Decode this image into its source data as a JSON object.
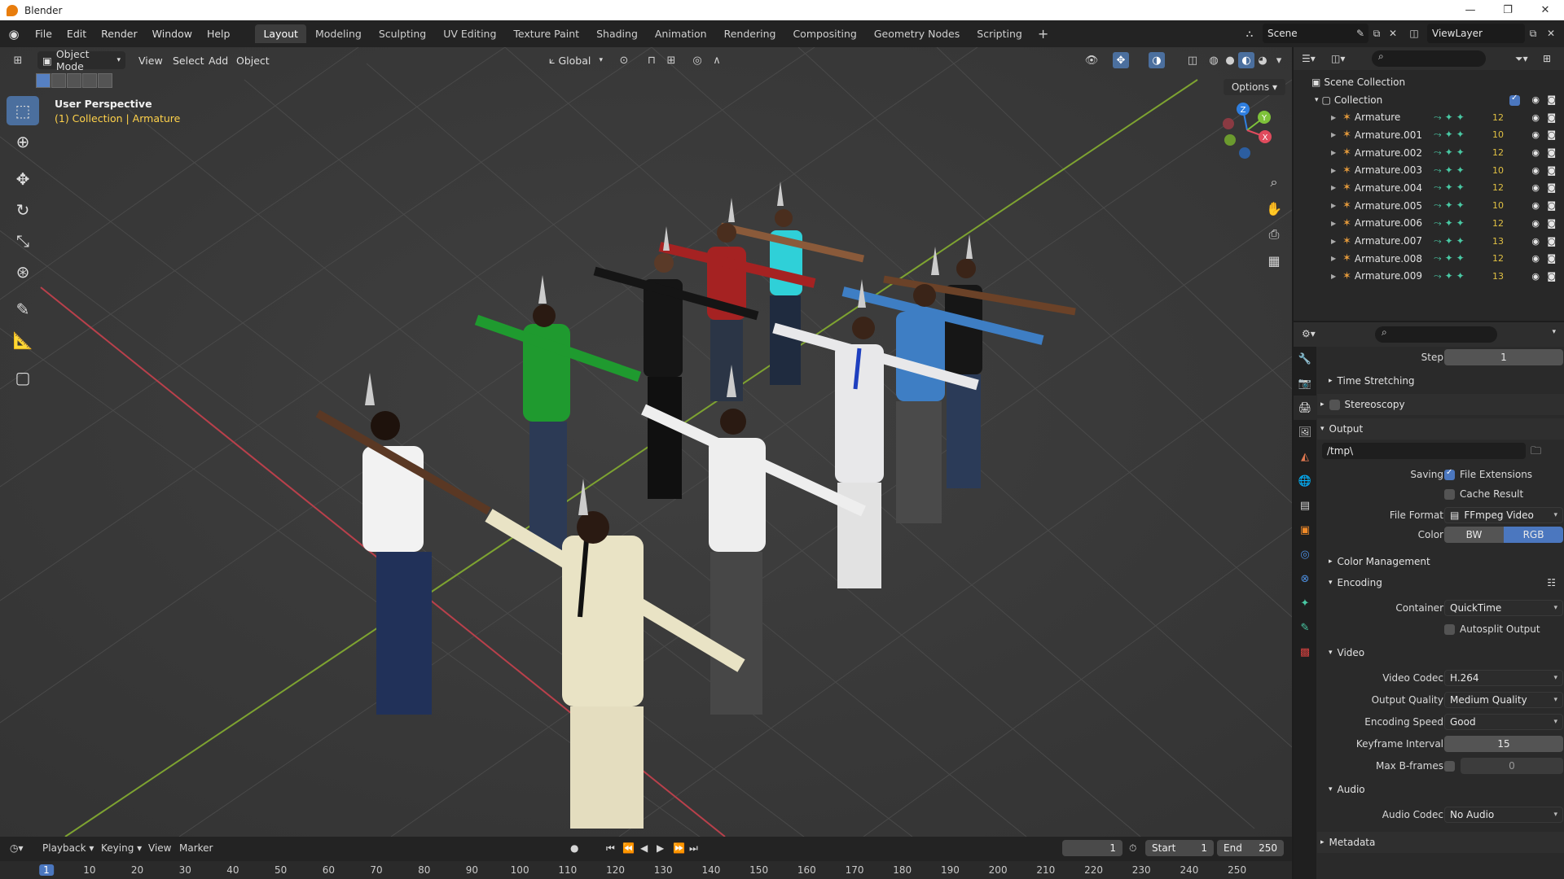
{
  "window": {
    "title": "Blender",
    "controls": [
      "—",
      "❐",
      "✕"
    ]
  },
  "menu": {
    "items": [
      "File",
      "Edit",
      "Render",
      "Window",
      "Help"
    ],
    "workspaces": [
      "Layout",
      "Modeling",
      "Sculpting",
      "UV Editing",
      "Texture Paint",
      "Shading",
      "Animation",
      "Rendering",
      "Compositing",
      "Geometry Nodes",
      "Scripting",
      "+"
    ],
    "active_workspace": "Layout",
    "scene": "Scene",
    "view_layer": "ViewLayer"
  },
  "viewport": {
    "mode": "Object Mode",
    "menus": [
      "View",
      "Select",
      "Add",
      "Object"
    ],
    "orientation": "Global",
    "options_label": "Options",
    "overlay_title": "User Perspective",
    "overlay_context": "(1) Collection | Armature",
    "gizmo_axes": [
      "Z",
      "Y",
      "X"
    ]
  },
  "outliner": {
    "root": "Scene Collection",
    "collection": "Collection",
    "items": [
      {
        "name": "Armature",
        "badge": "12"
      },
      {
        "name": "Armature.001",
        "badge": "10"
      },
      {
        "name": "Armature.002",
        "badge": "12"
      },
      {
        "name": "Armature.003",
        "badge": "10"
      },
      {
        "name": "Armature.004",
        "badge": "12"
      },
      {
        "name": "Armature.005",
        "badge": "10"
      },
      {
        "name": "Armature.006",
        "badge": "12"
      },
      {
        "name": "Armature.007",
        "badge": "13"
      },
      {
        "name": "Armature.008",
        "badge": "12"
      },
      {
        "name": "Armature.009",
        "badge": "13"
      }
    ]
  },
  "properties": {
    "step_label": "Step",
    "step_value": "1",
    "time_stretching": "Time Stretching",
    "stereoscopy": "Stereoscopy",
    "output": "Output",
    "output_path": "/tmp\\",
    "saving_label": "Saving",
    "file_extensions": "File Extensions",
    "cache_result": "Cache Result",
    "file_format_label": "File Format",
    "file_format": "FFmpeg Video",
    "color_label": "Color",
    "color_bw": "BW",
    "color_rgb": "RGB",
    "color_management": "Color Management",
    "encoding": "Encoding",
    "container_label": "Container",
    "container": "QuickTime",
    "autosplit": "Autosplit Output",
    "video": "Video",
    "video_codec_label": "Video Codec",
    "video_codec": "H.264",
    "output_quality_label": "Output Quality",
    "output_quality": "Medium Quality",
    "encoding_speed_label": "Encoding Speed",
    "encoding_speed": "Good",
    "keyframe_label": "Keyframe Interval",
    "keyframe_value": "15",
    "bframes_label": "Max B-frames",
    "bframes_value": "0",
    "audio": "Audio",
    "audio_codec_label": "Audio Codec",
    "audio_codec": "No Audio",
    "metadata": "Metadata"
  },
  "timeline": {
    "menus": [
      "Playback",
      "Keying",
      "View",
      "Marker"
    ],
    "current_frame": "1",
    "start_label": "Start",
    "start": "1",
    "end_label": "End",
    "end": "250",
    "ticks": [
      "1",
      "10",
      "20",
      "30",
      "40",
      "50",
      "60",
      "70",
      "80",
      "90",
      "100",
      "110",
      "120",
      "130",
      "140",
      "150",
      "160",
      "170",
      "180",
      "190",
      "200",
      "210",
      "220",
      "230",
      "240",
      "250"
    ]
  }
}
